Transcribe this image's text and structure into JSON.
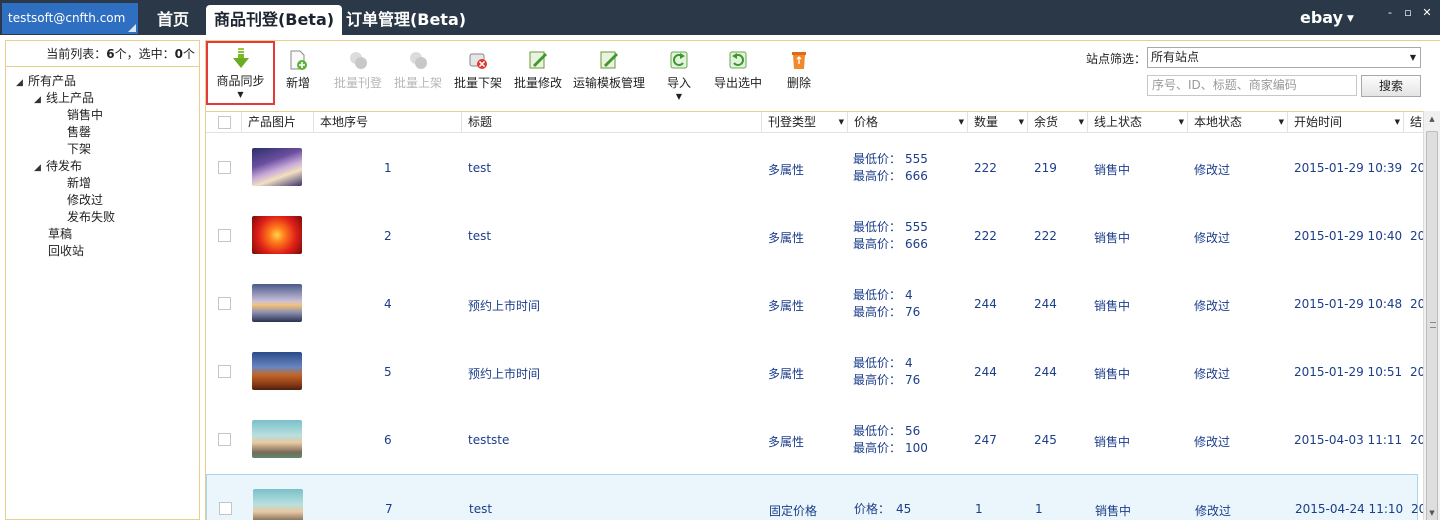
{
  "header": {
    "account": "testsoft@cnfth.com",
    "tabs": [
      {
        "label": "首页",
        "active": false
      },
      {
        "label": "商品刊登(Beta)",
        "active": true
      },
      {
        "label": "订单管理(Beta)",
        "active": false
      }
    ],
    "platform": "ebay",
    "window_controls": [
      "-",
      "▫",
      "✕"
    ]
  },
  "sidebar": {
    "status_prefix": "当前列表：",
    "status_count": "6",
    "status_mid": "个，选中：",
    "status_selected": "0",
    "status_suffix": "个",
    "tree": {
      "root": "所有产品",
      "online": "线上产品",
      "online_children": [
        "销售中",
        "售罄",
        "下架"
      ],
      "pending": "待发布",
      "pending_children": [
        "新增",
        "修改过",
        "发布失败"
      ],
      "draft": "草稿",
      "recycle": "回收站"
    }
  },
  "toolbar": {
    "buttons": [
      {
        "label": "商品同步",
        "icon": "sync-down-arrow-icon",
        "enabled": true,
        "dropdown": true,
        "highlighted": true
      },
      {
        "label": "新增",
        "icon": "new-document-icon",
        "enabled": true
      },
      {
        "label": "批量刊登",
        "icon": "batch-publish-icon",
        "enabled": false
      },
      {
        "label": "批量上架",
        "icon": "batch-list-icon",
        "enabled": false
      },
      {
        "label": "批量下架",
        "icon": "batch-delist-icon",
        "enabled": true
      },
      {
        "label": "批量修改",
        "icon": "batch-edit-icon",
        "enabled": true
      },
      {
        "label": "运输模板管理",
        "icon": "shipping-template-icon",
        "enabled": true
      },
      {
        "label": "导入",
        "icon": "import-icon",
        "enabled": true,
        "dropdown": true
      },
      {
        "label": "导出选中",
        "icon": "export-icon",
        "enabled": true
      },
      {
        "label": "删除",
        "icon": "recycle-bin-icon",
        "enabled": true
      }
    ],
    "site_filter_label": "站点筛选：",
    "site_filter_value": "所有站点",
    "search_placeholder": "序号、ID、标题、商家编码",
    "search_button": "搜索"
  },
  "grid": {
    "columns": [
      "产品图片",
      "本地序号",
      "标题",
      "刊登类型",
      "价格",
      "数量",
      "余货",
      "线上状态",
      "本地状态",
      "开始时间",
      "结"
    ],
    "price_labels": {
      "min": "最低价：",
      "max": "最高价：",
      "single": "价格："
    },
    "rows": [
      {
        "image": "winter-house",
        "local_no": "1",
        "title": "test",
        "type": "多属性",
        "min": "555",
        "max": "666",
        "qty": "222",
        "remain": "219",
        "online": "销售中",
        "local": "修改过",
        "start": "2015-01-29 10:39",
        "end": "20"
      },
      {
        "image": "red-flower",
        "local_no": "2",
        "title": "test",
        "type": "多属性",
        "min": "555",
        "max": "666",
        "qty": "222",
        "remain": "222",
        "online": "销售中",
        "local": "修改过",
        "start": "2015-01-29 10:40",
        "end": "20"
      },
      {
        "image": "winter-road",
        "local_no": "4",
        "title": "预约上市时间",
        "type": "多属性",
        "min": "4",
        "max": "76",
        "qty": "244",
        "remain": "244",
        "online": "销售中",
        "local": "修改过",
        "start": "2015-01-29 10:48",
        "end": "20"
      },
      {
        "image": "desert-rock",
        "local_no": "5",
        "title": "预约上市时间",
        "type": "多属性",
        "min": "4",
        "max": "76",
        "qty": "244",
        "remain": "244",
        "online": "销售中",
        "local": "修改过",
        "start": "2015-01-29 10:51",
        "end": "20"
      },
      {
        "image": "anime-scene",
        "local_no": "6",
        "title": "testste",
        "type": "多属性",
        "min": "56",
        "max": "100",
        "qty": "247",
        "remain": "245",
        "online": "销售中",
        "local": "修改过",
        "start": "2015-04-03 11:11",
        "end": "20"
      },
      {
        "image": "anime-scene",
        "local_no": "7",
        "title": "test",
        "type": "固定价格",
        "price": "45",
        "qty": "1",
        "remain": "1",
        "online": "销售中",
        "local": "修改过",
        "start": "2015-04-24 11:10",
        "end": "20",
        "selected": true
      }
    ]
  },
  "colors": {
    "topbar": "#2b3848",
    "account": "#2f6fc1",
    "border": "#e7cf8e",
    "highlight": "#e53a3a",
    "link": "#1b3d8a"
  }
}
